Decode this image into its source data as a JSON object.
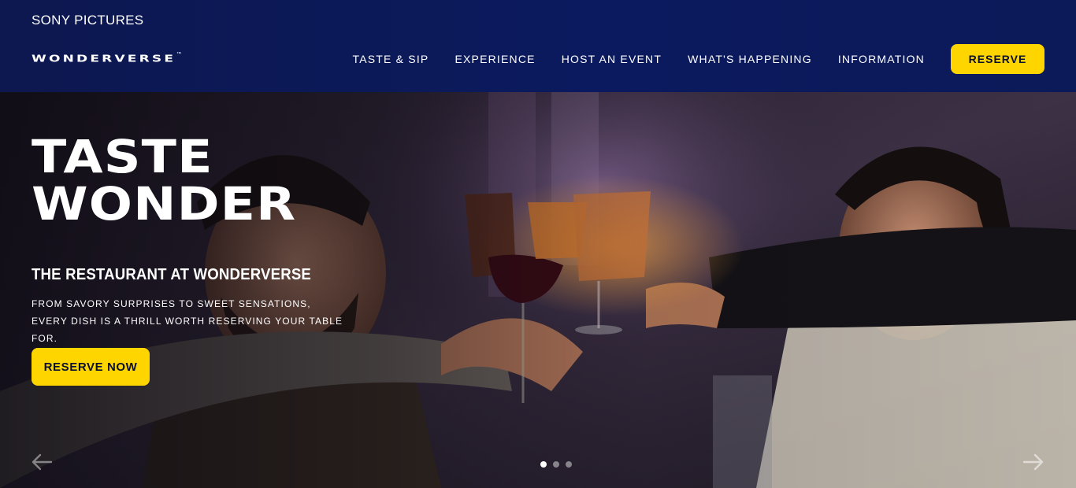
{
  "header": {
    "brand": "SONY PICTURES",
    "logo": "WONDERVERSE",
    "logo_tm": "™",
    "nav": [
      {
        "label": "TASTE & SIP"
      },
      {
        "label": "EXPERIENCE"
      },
      {
        "label": "HOST AN EVENT"
      },
      {
        "label": "WHAT'S HAPPENING"
      },
      {
        "label": "INFORMATION"
      }
    ],
    "reserve_label": "RESERVE"
  },
  "hero": {
    "title_line1": "TASTE",
    "title_line2": "WONDER",
    "subtitle": "THE RESTAURANT AT WONDERVERSE",
    "description": "FROM SAVORY SURPRISES TO SWEET SENSATIONS, EVERY DISH IS A THRILL WORTH RESERVING YOUR TABLE FOR.",
    "cta_label": "RESERVE NOW",
    "slides_total": 3,
    "active_slide": 1
  },
  "colors": {
    "header_bg": "#0b1a5e",
    "accent": "#ffd500",
    "button_text": "#0a0f2c"
  },
  "icons": {
    "prev": "arrow-left-icon",
    "next": "arrow-right-icon"
  }
}
